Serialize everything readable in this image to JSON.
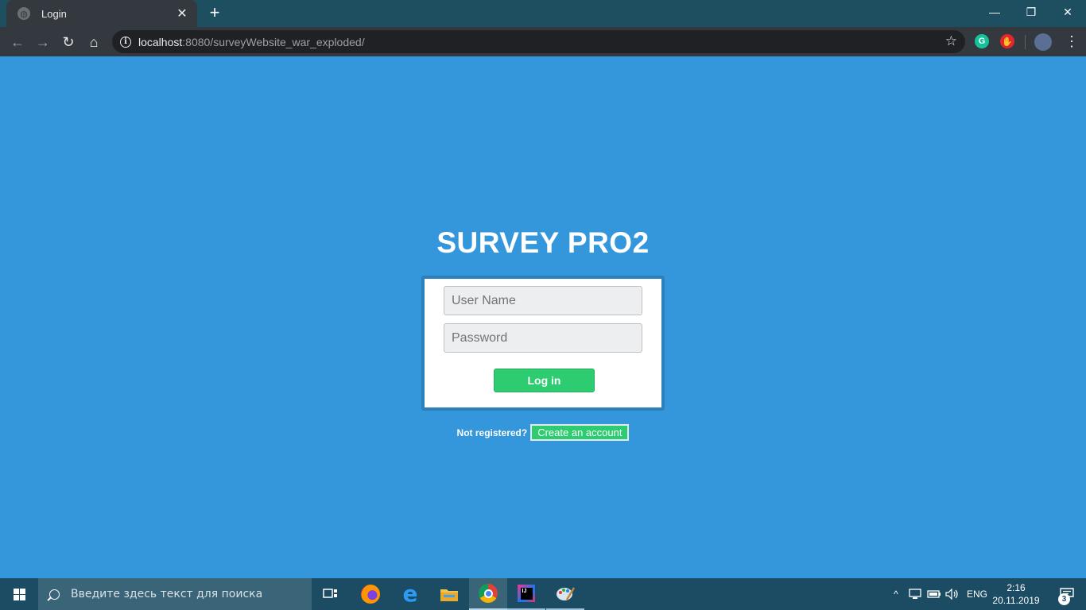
{
  "browser": {
    "tab": {
      "title": "Login",
      "favicon": "globe-icon"
    },
    "new_tab_label": "+",
    "window_controls": {
      "minimize": "—",
      "restore": "❐",
      "close": "✕"
    },
    "address": {
      "host": "localhost",
      "rest": ":8080/surveyWebsite_war_exploded/"
    },
    "extensions": [
      {
        "name": "grammarly-icon",
        "label": "G",
        "color": "#15c39a"
      },
      {
        "name": "adblock-icon",
        "label": "✋",
        "color": "#e3262e"
      }
    ]
  },
  "page": {
    "title": "SURVEY PRO2",
    "background": "#3597db",
    "username": {
      "value": "",
      "placeholder": "User Name"
    },
    "password": {
      "value": "",
      "placeholder": "Password"
    },
    "login_button": "Log in",
    "not_registered": "Not registered?",
    "create_account": "Create an account",
    "accent": "#2ecc71"
  },
  "taskbar": {
    "search_placeholder": "Введите здесь текст для поиска",
    "apps": [
      "task-view-icon",
      "firefox-icon",
      "edge-icon",
      "file-explorer-icon",
      "chrome-icon",
      "intellij-icon",
      "paint-icon"
    ],
    "language": "ENG",
    "time": "2:16",
    "date": "20.11.2019",
    "notifications": "3"
  }
}
